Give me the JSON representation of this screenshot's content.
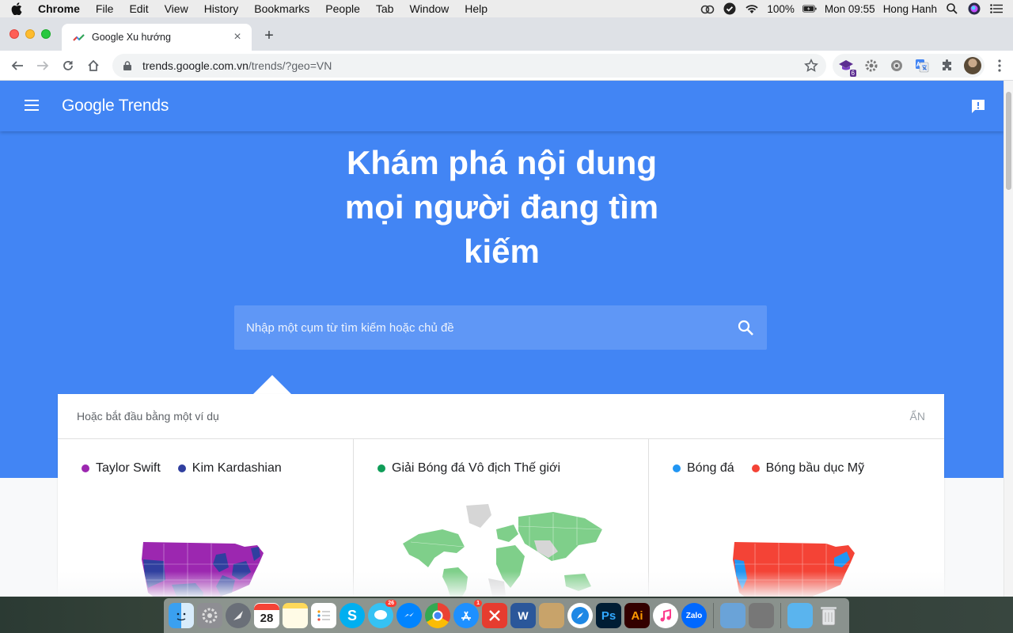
{
  "menubar": {
    "app": "Chrome",
    "items": [
      "File",
      "Edit",
      "View",
      "History",
      "Bookmarks",
      "People",
      "Tab",
      "Window",
      "Help"
    ],
    "battery": "100%",
    "clock": "Mon 09:55",
    "user": "Hong Hanh"
  },
  "browser": {
    "tab_title": "Google Xu hướng",
    "url_host": "trends.google.com.vn",
    "url_path": "/trends/?geo=VN",
    "extension_badge": "6"
  },
  "page": {
    "logo": "Google Trends",
    "headline_line1": "Khám phá nội dung",
    "headline_line2": "mọi người đang tìm",
    "headline_line3": "kiếm",
    "search_placeholder": "Nhập một cụm từ tìm kiếm hoặc chủ đề",
    "examples_title": "Hoặc bắt đầu bằng một ví dụ",
    "hide_label": "ẨN",
    "cards": [
      {
        "legend": [
          {
            "label": "Taylor Swift",
            "color": "#9c27b0"
          },
          {
            "label": "Kim Kardashian",
            "color": "#303f9f"
          }
        ]
      },
      {
        "legend": [
          {
            "label": "Giải Bóng đá Vô địch Thế giới",
            "color": "#0f9d58"
          }
        ]
      },
      {
        "legend": [
          {
            "label": "Bóng đá",
            "color": "#2196f3"
          },
          {
            "label": "Bóng bầu dục Mỹ",
            "color": "#f44336"
          }
        ]
      }
    ]
  },
  "colors": {
    "brand_blue": "#4285f4",
    "search_box": "#5f97f6"
  },
  "dock": {
    "calendar_day": "28",
    "messages_badge": "26",
    "appstore_badge": "1",
    "ps_label": "Ps",
    "ai_label": "Ai",
    "zalo_label": "Zalo",
    "skype_label": "S"
  }
}
